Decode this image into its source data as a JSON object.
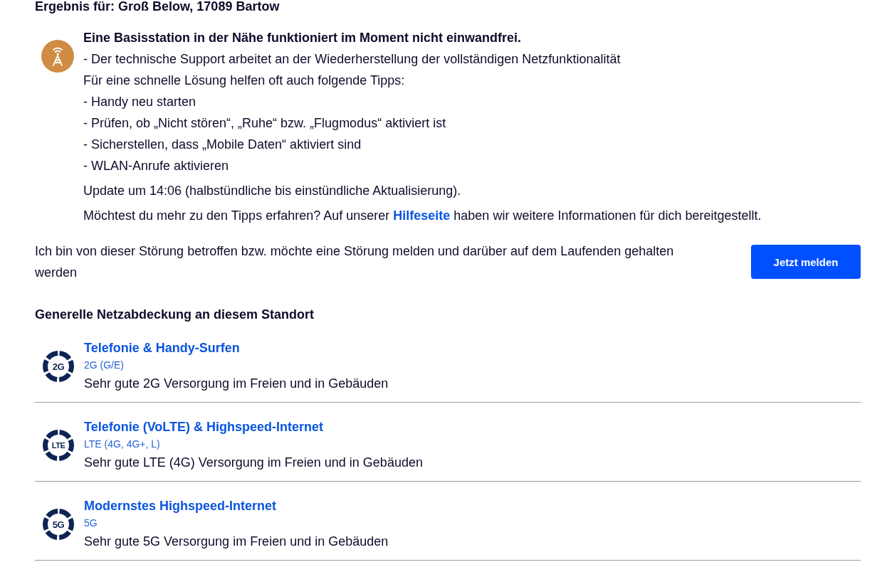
{
  "result_heading": "Ergebnis für: Groß Below, 17089 Bartow",
  "outage": {
    "title": "Eine Basisstation in der Nähe funktioniert im Moment nicht einwandfrei.",
    "lines": [
      "- Der technische Support arbeitet an der Wiederherstellung der vollständigen Netzfunktionalität",
      "Für eine schnelle Lösung helfen oft auch folgende Tipps:",
      "- Handy neu starten",
      "- Prüfen, ob „Nicht stören“, „Ruhe“ bzw. „Flugmodus“ aktiviert ist",
      "- Sicherstellen, dass „Mobile Daten“ aktiviert sind",
      "- WLAN-Anrufe aktivieren"
    ],
    "update": "Update um 14:06 (halbstündliche bis einstündliche Aktualisierung).",
    "more_info": {
      "before": "Möchtest du mehr zu den Tipps erfahren? Auf unserer",
      "link": "Hilfeseite",
      "after": "haben wir weitere Informationen für dich bereitgestellt."
    }
  },
  "report": {
    "text": "Ich bin von dieser Störung betroffen bzw. möchte eine Störung melden und darüber auf dem Laufenden gehalten werden",
    "button": "Jetzt melden"
  },
  "coverage": {
    "heading": "Generelle Netzabdeckung an diesem Standort",
    "items": [
      {
        "badge": "2G",
        "title": "Telefonie & Handy-Surfen",
        "technology": "2G (G/E)",
        "description": "Sehr gute 2G Versorgung im Freien und in Gebäuden"
      },
      {
        "badge": "LTE",
        "title": "Telefonie (VoLTE) & Highspeed-Internet",
        "technology": "LTE (4G, 4G+, L)",
        "description": "Sehr gute LTE (4G) Versorgung im Freien und in Gebäuden"
      },
      {
        "badge": "5G",
        "title": "Modernstes Highspeed-Internet",
        "technology": "5G",
        "description": "Sehr gute 5G Versorgung im Freien und in Gebäuden"
      }
    ]
  }
}
